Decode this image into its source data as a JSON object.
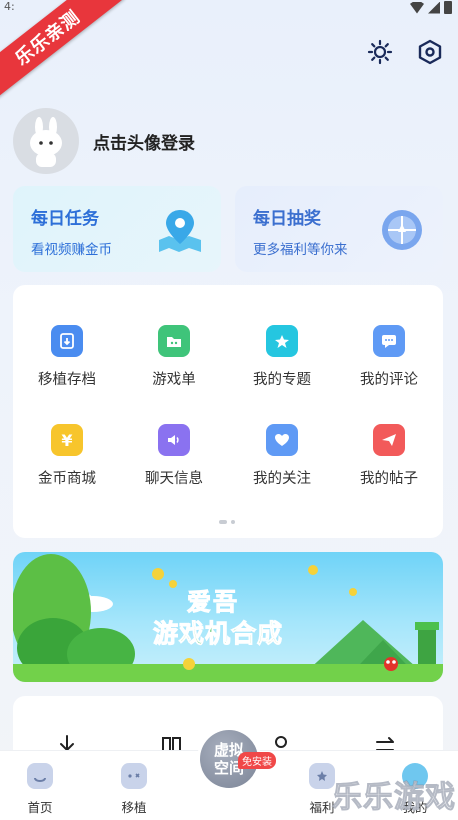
{
  "status_bar": {
    "time": "4:"
  },
  "ribbon": {
    "text": "乐乐亲测"
  },
  "profile": {
    "login_text": "点击头像登录"
  },
  "task_cards": {
    "daily": {
      "title": "每日任务",
      "subtitle": "看视频赚金币"
    },
    "lottery": {
      "title": "每日抽奖",
      "subtitle": "更多福利等你来"
    }
  },
  "grid": {
    "items": [
      {
        "label": "移植存档",
        "color": "#4a8cf0",
        "icon": "download-box-icon"
      },
      {
        "label": "游戏单",
        "color": "#3fc47a",
        "icon": "folder-game-icon"
      },
      {
        "label": "我的专题",
        "color": "#25c6e0",
        "icon": "star-badge-icon"
      },
      {
        "label": "我的评论",
        "color": "#4a8cf0",
        "icon": "comment-icon"
      },
      {
        "label": "金币商城",
        "color": "#f7c52c",
        "icon": "yen-coin-icon"
      },
      {
        "label": "聊天信息",
        "color": "#8a72f0",
        "icon": "speaker-icon"
      },
      {
        "label": "我的关注",
        "color": "#4a8cf0",
        "icon": "heart-icon"
      },
      {
        "label": "我的帖子",
        "color": "#f25a5a",
        "icon": "send-icon"
      }
    ]
  },
  "banner": {
    "line1": "爱吾",
    "line2": "游戏机合成"
  },
  "tabbar": {
    "tabs": [
      {
        "label": "首页",
        "icon": "home-icon"
      },
      {
        "label": "移植",
        "icon": "gamepad-icon"
      },
      {
        "label": "福利",
        "icon": "gift-star-icon"
      },
      {
        "label": "我的",
        "icon": "profile-icon"
      }
    ],
    "center_label": "虚拟空间",
    "center_badge": "免安装"
  },
  "watermark": "乐乐游戏"
}
